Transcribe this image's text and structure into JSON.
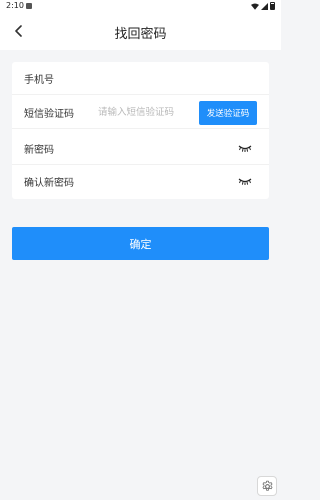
{
  "status_bar": {
    "time": "2:10"
  },
  "header": {
    "title": "找回密码"
  },
  "form": {
    "phone_label": "手机号",
    "phone_value": "",
    "sms_label": "短信验证码",
    "sms_placeholder": "请输入短信验证码",
    "sms_value": "",
    "send_code_label": "发送验证码",
    "new_password_label": "新密码",
    "new_password_value": "",
    "confirm_password_label": "确认新密码",
    "confirm_password_value": ""
  },
  "confirm_button_label": "确定",
  "colors": {
    "accent": "#1f8efa",
    "background": "#f4f5f7",
    "card": "#ffffff"
  },
  "icons": {
    "back": "chevron-left-icon",
    "eye": "eye-closed-icon",
    "settings": "gear-icon"
  }
}
